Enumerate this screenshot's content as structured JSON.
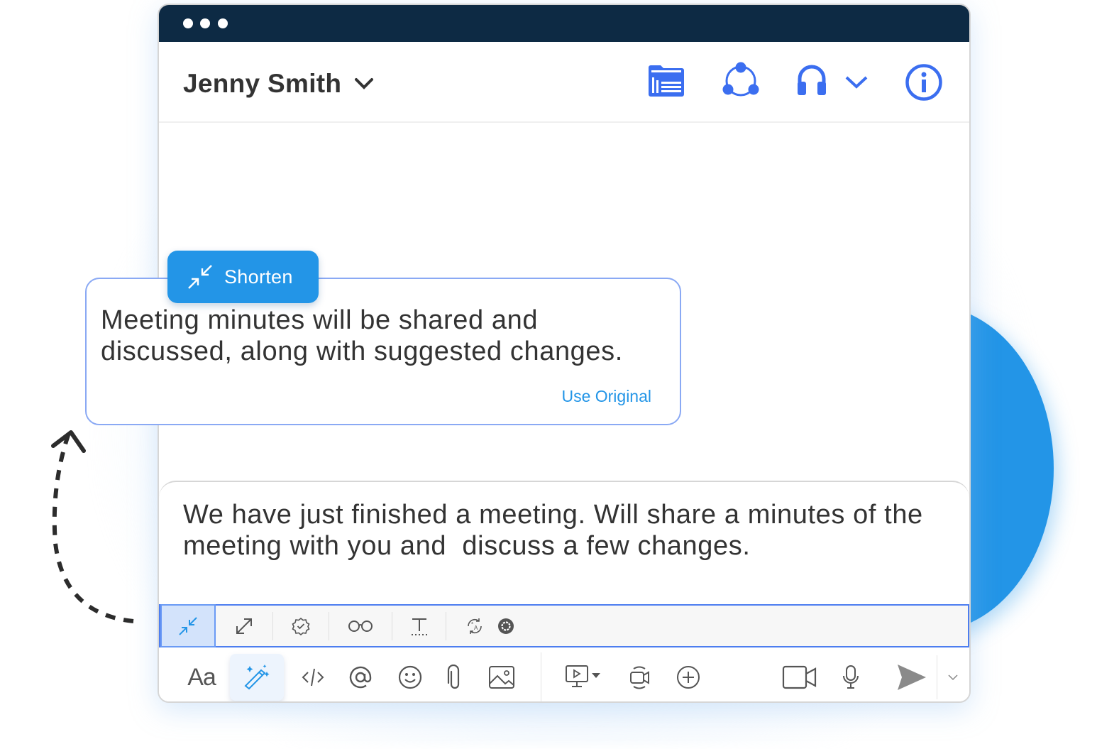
{
  "window": {
    "titlebar_dots": 3,
    "colors": {
      "titlebar": "#0d2a44",
      "accent": "#3b6ef0",
      "brand_blue": "#2395e7"
    }
  },
  "header": {
    "contact_name": "Jenny Smith",
    "icons": [
      "folder-list-icon",
      "share-network-icon",
      "headset-icon",
      "chevron-down-icon",
      "info-icon"
    ]
  },
  "suggestion": {
    "action_label": "Shorten",
    "text": "Meeting minutes will be shared and discussed, along with suggested changes.",
    "use_original_label": "Use Original"
  },
  "composer": {
    "text": "We have just finished a meeting. Will share a minutes of the meeting with you and  discuss a few changes."
  },
  "ai_toolbar": {
    "items": [
      {
        "name": "shorten",
        "icon": "shorten-icon",
        "active": true
      },
      {
        "name": "expand",
        "icon": "expand-icon",
        "active": false
      },
      {
        "name": "proofread",
        "icon": "badge-check-icon",
        "active": false
      },
      {
        "name": "readability",
        "icon": "glasses-icon",
        "active": false
      },
      {
        "name": "text-format",
        "icon": "text-icon",
        "active": false
      },
      {
        "name": "translate",
        "icon": "translate-icon",
        "active": false
      },
      {
        "name": "settings",
        "icon": "gear-icon",
        "active": false
      }
    ]
  },
  "bottom_bar": {
    "format_label": "Aa",
    "items": [
      "format-text",
      "ai-magic-wand",
      "code-snippet",
      "mention",
      "emoji",
      "attachment",
      "image",
      "screen-share",
      "video-message",
      "add",
      "video-call",
      "microphone",
      "send",
      "send-options"
    ]
  }
}
